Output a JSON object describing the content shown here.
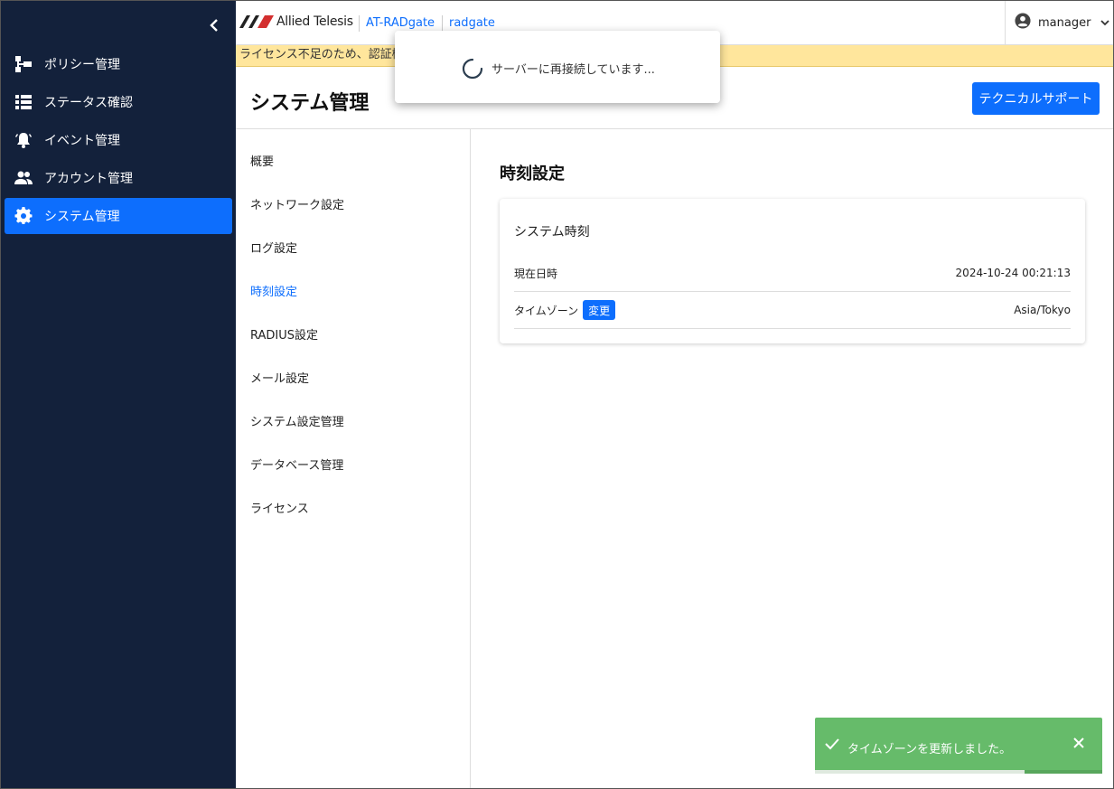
{
  "sidebar": {
    "items": [
      {
        "label": "ポリシー管理",
        "icon": "sitemap-icon"
      },
      {
        "label": "ステータス確認",
        "icon": "list-icon"
      },
      {
        "label": "イベント管理",
        "icon": "bell-icon"
      },
      {
        "label": "アカウント管理",
        "icon": "users-icon"
      },
      {
        "label": "システム管理",
        "icon": "gear-icon",
        "active": true
      }
    ]
  },
  "topbar": {
    "brand": "Allied Telesis",
    "product": "AT-RADgate",
    "host": "radgate",
    "user": "manager"
  },
  "banner": {
    "text": "ライセンス不足のため、認証機"
  },
  "header": {
    "title": "システム管理",
    "support_label": "テクニカルサポート"
  },
  "subnav": {
    "items": [
      "概要",
      "ネットワーク設定",
      "ログ設定",
      "時刻設定",
      "RADIUS設定",
      "メール設定",
      "システム設定管理",
      "データベース管理",
      "ライセンス"
    ],
    "active_index": 3
  },
  "main": {
    "section_title": "時刻設定",
    "card_title": "システム時刻",
    "rows": [
      {
        "label": "現在日時",
        "value": "2024-10-24 00:21:13"
      },
      {
        "label": "タイムゾーン",
        "value": "Asia/Tokyo",
        "button": "変更"
      }
    ]
  },
  "modal": {
    "text": "サーバーに再接続しています..."
  },
  "toast": {
    "message": "タイムゾーンを更新しました。",
    "progress": 0.73
  },
  "colors": {
    "sidebar_bg": "#13213b",
    "accent": "#0d6efd",
    "banner_bg": "#ffe69c",
    "toast_bg": "#66bb6a"
  }
}
